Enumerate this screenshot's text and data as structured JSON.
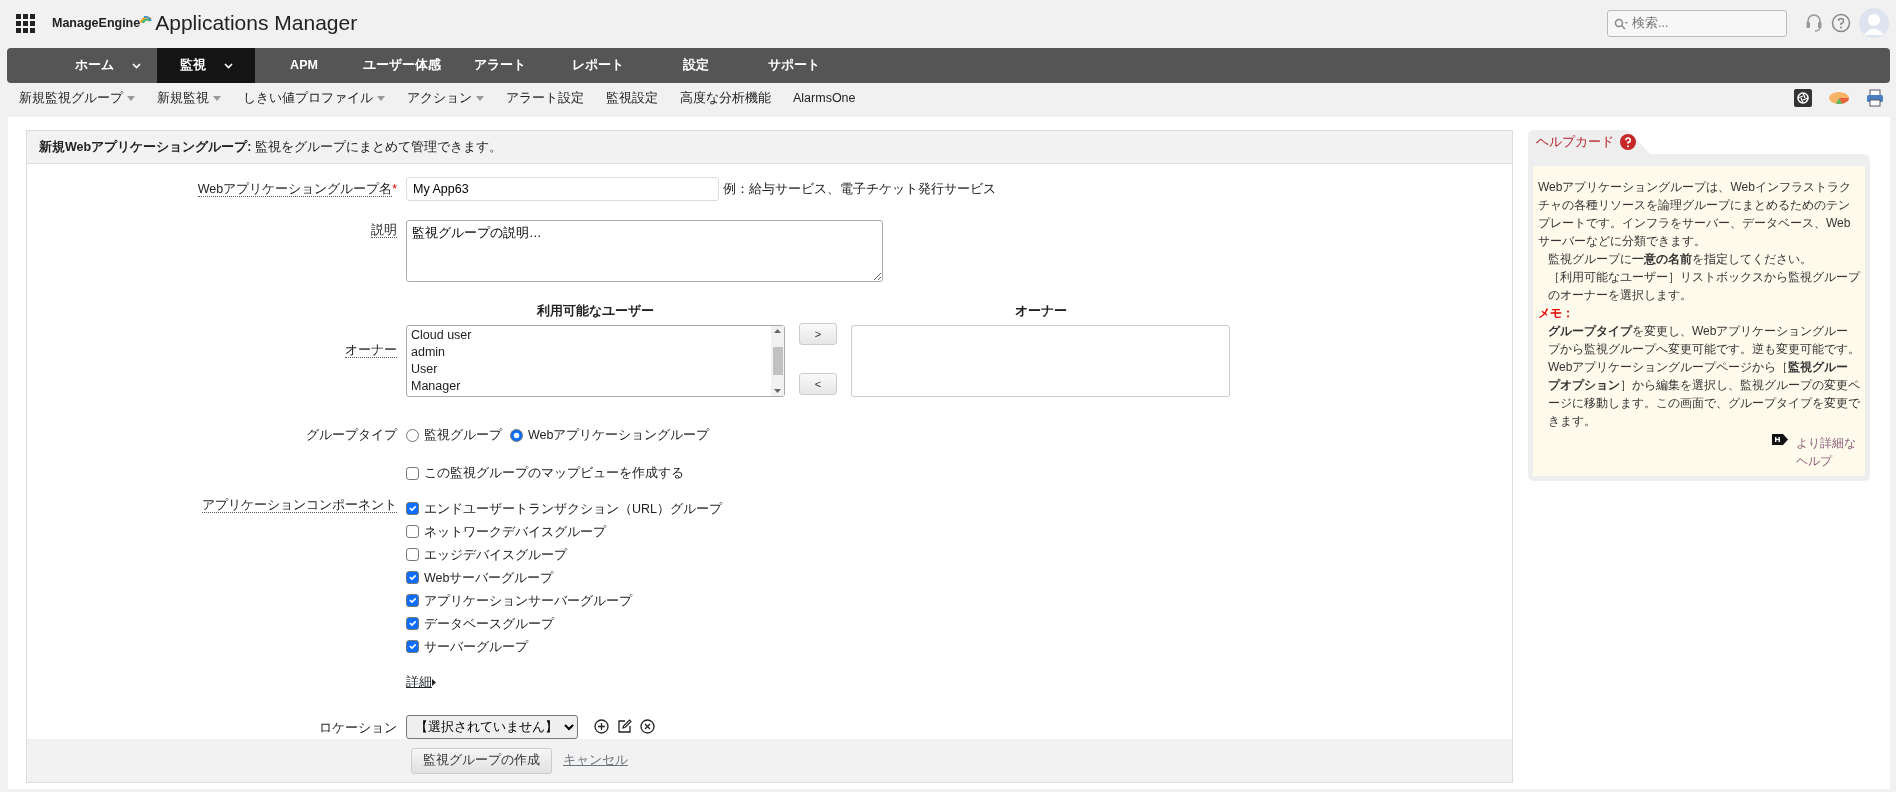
{
  "header": {
    "brand": "ManageEngine",
    "app_name": "Applications Manager",
    "search": {
      "placeholder": "検索..."
    }
  },
  "main_nav": [
    {
      "label": "ホーム",
      "dropdown": true,
      "selected": false
    },
    {
      "label": "監視",
      "dropdown": true,
      "selected": true
    },
    {
      "label": "APM",
      "dropdown": false,
      "selected": false
    },
    {
      "label": "ユーザー体感",
      "dropdown": false,
      "selected": false
    },
    {
      "label": "アラート",
      "dropdown": false,
      "selected": false
    },
    {
      "label": "レポート",
      "dropdown": false,
      "selected": false
    },
    {
      "label": "設定",
      "dropdown": false,
      "selected": false
    },
    {
      "label": "サポート",
      "dropdown": false,
      "selected": false
    }
  ],
  "sub_nav": [
    {
      "label": "新規監視グループ",
      "dropdown": true
    },
    {
      "label": "新規監視",
      "dropdown": true
    },
    {
      "label": "しきい値プロファイル",
      "dropdown": true
    },
    {
      "label": "アクション",
      "dropdown": true
    },
    {
      "label": "アラート設定",
      "dropdown": false
    },
    {
      "label": "監視設定",
      "dropdown": false
    },
    {
      "label": "高度な分析機能",
      "dropdown": false
    },
    {
      "label": "AlarmsOne",
      "dropdown": false
    }
  ],
  "form": {
    "title": "**新規Webアプリケーショングループ:** 監視をグループにまとめて管理できます。",
    "name_field": {
      "label": "Webアプリケーショングループ名",
      "required_mark": "*",
      "value": "My App63",
      "hint": "例：給与サービス、電子チケット発行サービス"
    },
    "description_field": {
      "label": "説明",
      "value": "監視グループの説明…"
    },
    "owner": {
      "label": "オーナー",
      "available_heading": "利用可能なユーザー",
      "available_users": [
        "Cloud user",
        "admin",
        "User",
        "Manager"
      ],
      "add_button": ">",
      "remove_button": "<",
      "owners_heading": "オーナー"
    },
    "group_type": {
      "label": "グループタイプ",
      "options": [
        {
          "label": "監視グループ",
          "selected": false
        },
        {
          "label": "Webアプリケーショングループ",
          "selected": true
        }
      ]
    },
    "map_view": {
      "label": "この監視グループのマップビューを作成する",
      "checked": false
    },
    "components": {
      "label": "アプリケーションコンポーネント",
      "items": [
        {
          "label": "エンドユーザートランザクション（URL）グループ",
          "checked": true
        },
        {
          "label": "ネットワークデバイスグループ",
          "checked": false
        },
        {
          "label": "エッジデバイスグループ",
          "checked": false
        },
        {
          "label": "Webサーバーグループ",
          "checked": true
        },
        {
          "label": "アプリケーションサーバーグループ",
          "checked": true
        },
        {
          "label": "データベースグループ",
          "checked": true
        },
        {
          "label": "サーバーグループ",
          "checked": true
        }
      ]
    },
    "details_link": "詳細",
    "location": {
      "label": "ロケーション",
      "value": "【選択されていません】"
    },
    "submit_button": "監視グループの作成",
    "cancel_link": "キャンセル"
  },
  "help_card": {
    "title": "ヘルプカード",
    "intro": "Webアプリケーショングループは、Webインフラストラクチャの各種リソースを論理グループにまとめるためのテンプレートです。インフラをサーバー、データベース、Webサーバーなどに分類できます。",
    "tips": [
      "監視グループに**一意の名前**を指定してください。",
      "［利用可能なユーザー］リストボックスから監視グループのオーナーを選択します。"
    ],
    "memo_label": "メモ：",
    "memo_items": [
      "**グループタイプ**を変更し、Webアプリケーショングループから監視グループへ変更可能です。逆も変更可能です。",
      "Webアプリケーショングループページから［**監視グループオプション**］から編集を選択し、監視グループの変更ページに移動します。この画面で、グループタイプを変更できます。"
    ],
    "more_link": "より詳細なヘルプ"
  }
}
